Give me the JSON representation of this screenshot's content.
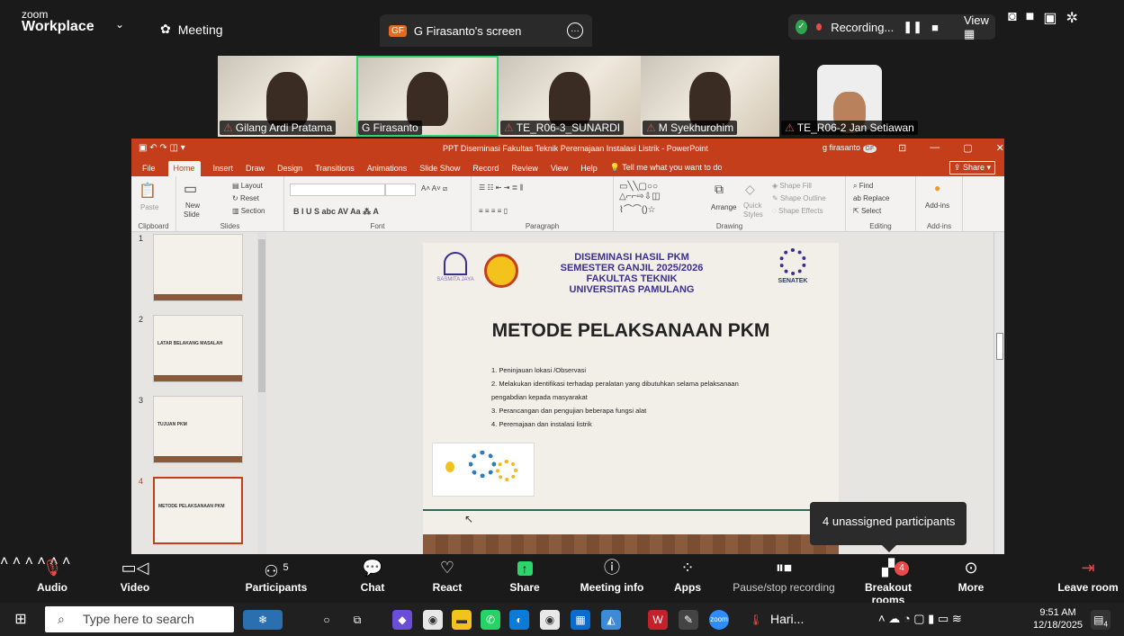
{
  "zoom": {
    "brand_small": "zoom",
    "brand_big": "Workplace",
    "meeting_label": "Meeting",
    "screen_badge": "GF",
    "screen_tab": "G Firasanto's screen",
    "recording": "Recording...",
    "view_label": "View"
  },
  "participants": [
    {
      "name": "Gilang Ardi Pratama",
      "muted": true
    },
    {
      "name": "G Firasanto",
      "muted": false,
      "active": true
    },
    {
      "name": "TE_R06-3_SUNARDI",
      "muted": true
    },
    {
      "name": "M Syekhurohim",
      "muted": true
    },
    {
      "name": "TE_R06-2 Jan Setiawan",
      "muted": true
    }
  ],
  "ppt": {
    "window_title": "PPT Diseminasi Fakultas Teknik Peremajaan Instalasi Listrik  -  PowerPoint",
    "user": "g firasanto",
    "user_initials": "GF",
    "menu": [
      "File",
      "Home",
      "Insert",
      "Draw",
      "Design",
      "Transitions",
      "Animations",
      "Slide Show",
      "Record",
      "Review",
      "View",
      "Help"
    ],
    "tell_me": "Tell me what you want to do",
    "share": "Share",
    "ribbon": {
      "clipboard": "Clipboard",
      "paste": "Paste",
      "slides": "Slides",
      "new_slide": "New",
      "new_slide2": "Slide",
      "layout": "Layout",
      "reset": "Reset",
      "section": "Section",
      "font": "Font",
      "paragraph": "Paragraph",
      "drawing": "Drawing",
      "arrange": "Arrange",
      "quick_styles": "Quick",
      "quick_styles2": "Styles",
      "shape_fill": "Shape Fill",
      "shape_outline": "Shape Outline",
      "shape_effects": "Shape Effects",
      "editing": "Editing",
      "find": "Find",
      "replace": "Replace",
      "select": "Select",
      "addins_btn": "Add-ins",
      "addins": "Add-ins"
    },
    "slide_thumbs": [
      {
        "num": "1",
        "title": ""
      },
      {
        "num": "2",
        "title": "LATAR BELAKANG MASALAH"
      },
      {
        "num": "3",
        "title": "TUJUAN PKM"
      },
      {
        "num": "4",
        "title": "METODE PELAKSANAAN PKM"
      }
    ],
    "slide": {
      "header_lines": [
        "DISEMINASI HASIL PKM",
        "SEMESTER GANJIL 2025/2026",
        "FAKULTAS TEKNIK",
        "UNIVERSITAS PAMULANG"
      ],
      "left_logo_text": "SASMITA JAYA",
      "right_logo_text": "SENATEK",
      "title": "METODE PELAKSANAAN PKM",
      "items": [
        "1. Peninjauan lokasi /Observasi",
        "2. Melakukan identifikasi terhadap peralatan yang dibutuhkan selama pelaksanaan",
        "pengabdian kepada masyarakat",
        "3. Perancangan dan pengujian beberapa fungsi alat",
        "4. Peremajaan dan instalasi listrik"
      ]
    }
  },
  "tooltip": "4 unassigned participants",
  "controls": {
    "audio": "Audio",
    "video": "Video",
    "participants": "Participants",
    "participants_count": "5",
    "chat": "Chat",
    "react": "React",
    "share": "Share",
    "meeting_info": "Meeting info",
    "apps": "Apps",
    "pause_recording": "Pause/stop recording",
    "breakout": "Breakout rooms",
    "breakout_count": "4",
    "more": "More",
    "leave": "Leave room"
  },
  "taskbar": {
    "search_placeholder": "Type here to search",
    "weather": "Hari...",
    "time": "9:51 AM",
    "date": "12/18/2025",
    "notif_count": "4"
  },
  "colors": {
    "ppt_red": "#c43e1c",
    "zoom_dark": "#1a1a1a",
    "active_green": "#2dd66b",
    "record_red": "#e84a4a"
  }
}
